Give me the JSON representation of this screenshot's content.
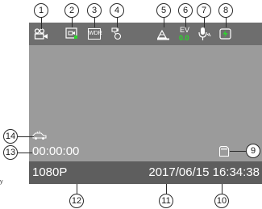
{
  "screen": {
    "top_icons": {
      "video_mode": "video-camera-icon",
      "screen_record": "screen-record-icon",
      "wdr": {
        "icon": "wdr-icon",
        "text": "WDR"
      },
      "motion_detection": "motion-detection-icon",
      "exposure_level": "exposure-icon",
      "ev": {
        "label": "EV",
        "value": "0.0"
      },
      "microphone": "microphone-icon",
      "battery": "battery-charging-icon"
    },
    "gsensor_icon": "car-collision-icon",
    "timer": "00:00:00",
    "sd_card_icon": "sd-card-icon",
    "resolution": "1080P",
    "date": "2017/06/15",
    "time": "16:34:38",
    "datetime": "2017/06/15 16:34:38"
  },
  "callouts": [
    "1",
    "2",
    "3",
    "4",
    "5",
    "6",
    "7",
    "8",
    "9",
    "10",
    "11",
    "12",
    "13",
    "14"
  ],
  "margin_text": "y",
  "colors": {
    "screen_bg": "#9b9b9b",
    "topbar_bg": "#6e6e6e",
    "bottombar_bg": "#5e5e5e",
    "ev_value": "#2bd82b",
    "battery_accent": "#2bd82b"
  }
}
